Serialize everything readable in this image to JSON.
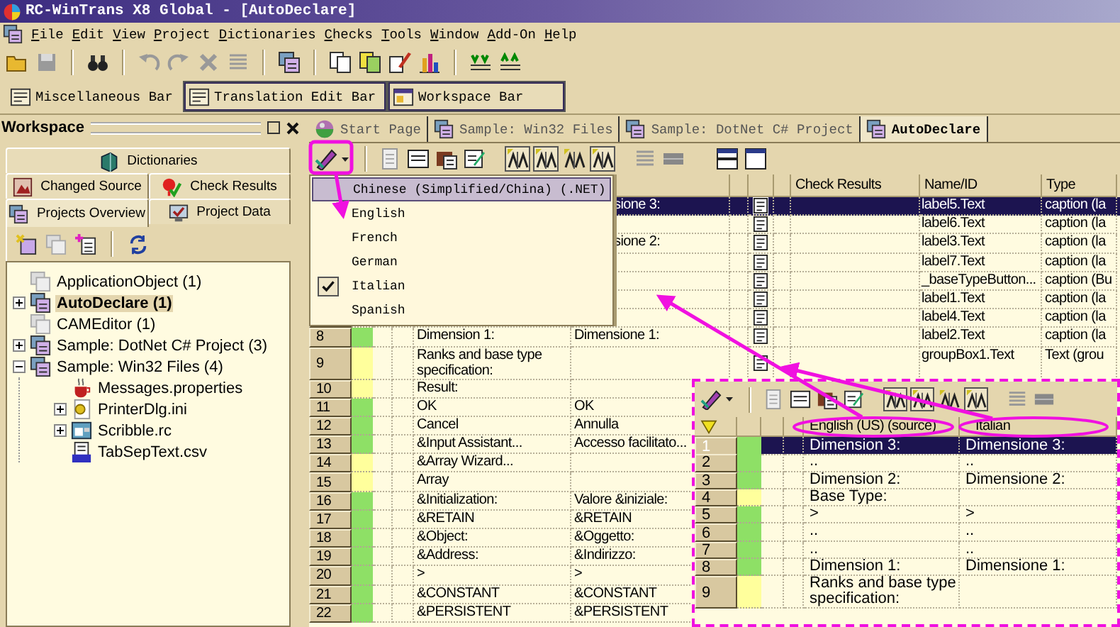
{
  "window": {
    "title": "RC-WinTrans X8 Global - [AutoDeclare]"
  },
  "menu": [
    "File",
    "Edit",
    "View",
    "Project",
    "Dictionaries",
    "Checks",
    "Tools",
    "Window",
    "Add-On",
    "Help"
  ],
  "toolbars": [
    {
      "label": "Miscellaneous Bar",
      "pressed": false
    },
    {
      "label": "Translation Edit Bar",
      "pressed": true
    },
    {
      "label": "Workspace Bar",
      "pressed": true
    }
  ],
  "workspace": {
    "title": "Workspace",
    "tab_rows": [
      {
        "tabs": [
          {
            "label": "Dictionaries",
            "selected": false
          }
        ]
      },
      {
        "tabs": [
          {
            "label": "Changed Source",
            "selected": false
          },
          {
            "label": "Check Results",
            "selected": false
          }
        ]
      },
      {
        "tabs": [
          {
            "label": "Projects Overview",
            "selected": true
          },
          {
            "label": "Project Data",
            "selected": false
          }
        ]
      }
    ],
    "tree": [
      {
        "label": "ApplicationObject (1)",
        "kind": "project",
        "disabled": true,
        "selected": false
      },
      {
        "label": "AutoDeclare (1)",
        "kind": "project",
        "disabled": false,
        "selected": true,
        "expanded": false
      },
      {
        "label": "CAMEditor (1)",
        "kind": "project",
        "disabled": true,
        "selected": false
      },
      {
        "label": "Sample: DotNet C# Project (3)",
        "kind": "project",
        "disabled": false,
        "selected": false,
        "expanded": false
      },
      {
        "label": "Sample: Win32 Files (4)",
        "kind": "project",
        "disabled": false,
        "selected": false,
        "expanded": true,
        "children": [
          {
            "label": "Messages.properties",
            "kind": "properties",
            "disabled": false,
            "selected": false
          },
          {
            "label": "PrinterDlg.ini",
            "kind": "ini",
            "disabled": false,
            "selected": false,
            "expanded": false
          },
          {
            "label": "Scribble.rc",
            "kind": "rc",
            "disabled": false,
            "selected": false,
            "expanded": false
          },
          {
            "label": "TabSepText.csv",
            "kind": "csv",
            "disabled": false,
            "selected": false
          }
        ]
      }
    ]
  },
  "document_tabs": [
    {
      "label": "Start Page",
      "selected": false
    },
    {
      "label": "Sample: Win32 Files",
      "selected": false
    },
    {
      "label": "Sample: DotNet C# Project",
      "selected": false
    },
    {
      "label": "AutoDeclare",
      "selected": true
    }
  ],
  "doc_toolbar": {
    "toggles": [
      {
        "pressed": true
      },
      {
        "pressed": true
      },
      {
        "pressed": false
      },
      {
        "pressed": true
      }
    ]
  },
  "language_menu": [
    {
      "label": "Chinese (Simplified/China) (.NET)",
      "selected": true,
      "checked": false
    },
    {
      "label": "English",
      "selected": false,
      "checked": false
    },
    {
      "label": "French",
      "selected": false,
      "checked": false
    },
    {
      "label": "German",
      "selected": false,
      "checked": false
    },
    {
      "label": "Italian",
      "selected": false,
      "checked": true
    },
    {
      "label": "Spanish",
      "selected": false,
      "checked": false
    }
  ],
  "grid": {
    "headers": {
      "check_results": "Check Results",
      "name_id": "Name/ID",
      "type": "Type"
    },
    "rows": [
      {
        "under_menu": true,
        "selected": true,
        "italian": "sione 3:",
        "name_id": "label5.Text",
        "type": "caption (la"
      },
      {
        "under_menu": true,
        "selected": false,
        "name_id": "label6.Text",
        "type": "caption (la"
      },
      {
        "under_menu": true,
        "selected": false,
        "italian": "sione 2:",
        "name_id": "label3.Text",
        "type": "caption (la"
      },
      {
        "under_menu": true,
        "selected": false,
        "name_id": "label7.Text",
        "type": "caption (la"
      },
      {
        "under_menu": true,
        "selected": false,
        "name_id": "_baseTypeButton...",
        "type": "caption (Bu"
      },
      {
        "under_menu": true,
        "selected": false,
        "name_id": "label1.Text",
        "type": "caption (la"
      },
      {
        "under_menu": true,
        "selected": false,
        "name_id": "label4.Text",
        "type": "caption (la"
      },
      {
        "number": "8",
        "color": "#8ee066",
        "selected": false,
        "english": "Dimension 1:",
        "italian": "Dimensione 1:",
        "name_id": "label2.Text",
        "type": "caption (la"
      },
      {
        "number": "9",
        "color": "#ffff9c",
        "selected": false,
        "english": "Ranks and base type specification:",
        "name_id": "groupBox1.Text",
        "type": "Text (grou"
      },
      {
        "number": "10",
        "color": "#ffff9c",
        "selected": false,
        "english": "Result:"
      },
      {
        "number": "11",
        "color": "#8ee066",
        "selected": false,
        "english": "OK",
        "italian": "OK"
      },
      {
        "number": "12",
        "color": "#8ee066",
        "selected": false,
        "english": "Cancel",
        "italian": "Annulla"
      },
      {
        "number": "13",
        "color": "#8ee066",
        "selected": false,
        "english": "&Input Assistant...",
        "italian": "Accesso facilitato..."
      },
      {
        "number": "14",
        "color": "#ffff9c",
        "selected": false,
        "english": "&Array Wizard..."
      },
      {
        "number": "15",
        "color": "#ffff9c",
        "selected": false,
        "english": "Array"
      },
      {
        "number": "16",
        "color": "#8ee066",
        "selected": false,
        "english": "&Initialization:",
        "italian": "Valore &iniziale:"
      },
      {
        "number": "17",
        "color": "#8ee066",
        "selected": false,
        "english": "&RETAIN",
        "italian": "&RETAIN"
      },
      {
        "number": "18",
        "color": "#8ee066",
        "selected": false,
        "english": "&Object:",
        "italian": "&Oggetto:"
      },
      {
        "number": "19",
        "color": "#8ee066",
        "selected": false,
        "english": "&Address:",
        "italian": "&Indirizzo:"
      },
      {
        "number": "20",
        "color": "#8ee066",
        "selected": false,
        "english": ">",
        "italian": ">"
      },
      {
        "number": "21",
        "color": "#8ee066",
        "selected": false,
        "english": "&CONSTANT",
        "italian": "&CONSTANT"
      },
      {
        "number": "22",
        "color": "#8ee066",
        "selected": false,
        "english": "&PERSISTENT",
        "italian": "&PERSISTENT"
      }
    ]
  },
  "inset": {
    "toggles": [
      {
        "pressed": true
      },
      {
        "pressed": true
      },
      {
        "pressed": false
      },
      {
        "pressed": true
      }
    ],
    "headers": {
      "english": "English (US) (source)",
      "italian": "Italian"
    },
    "rows": [
      {
        "number": "1",
        "color": "#8ee066",
        "selected": true,
        "english": "Dimension 3:",
        "italian": "Dimensione 3:"
      },
      {
        "number": "2",
        "color": "#8ee066",
        "selected": false,
        "english": "..",
        "italian": ".."
      },
      {
        "number": "3",
        "color": "#8ee066",
        "selected": false,
        "english": "Dimension 2:",
        "italian": "Dimensione 2:"
      },
      {
        "number": "4",
        "color": "#ffff9c",
        "selected": false,
        "english": "Base Type:"
      },
      {
        "number": "5",
        "color": "#8ee066",
        "selected": false,
        "english": ">",
        "italian": ">"
      },
      {
        "number": "6",
        "color": "#8ee066",
        "selected": false,
        "english": "..",
        "italian": ".."
      },
      {
        "number": "7",
        "color": "#8ee066",
        "selected": false,
        "english": "..",
        "italian": ".."
      },
      {
        "number": "8",
        "color": "#8ee066",
        "selected": false,
        "english": "Dimension 1:",
        "italian": "Dimensione 1:"
      },
      {
        "number": "9",
        "color": "#ffff9c",
        "selected": false,
        "english": "Ranks and base type specification:"
      }
    ]
  }
}
